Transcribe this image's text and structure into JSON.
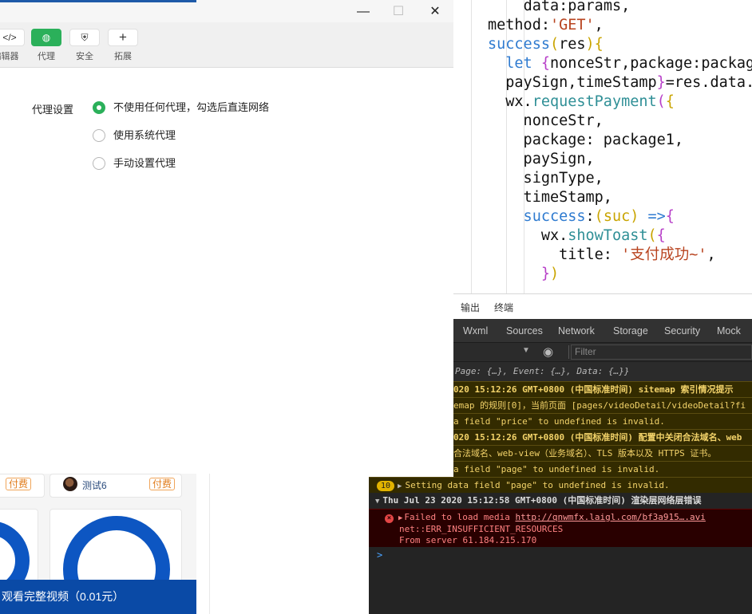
{
  "editor": {
    "lines": [
      [
        {
          "t": "    ",
          "c": "d"
        },
        {
          "t": "data",
          "c": "d"
        },
        {
          "t": ":params,",
          "c": "d"
        }
      ],
      [
        {
          "t": "method",
          "c": "d"
        },
        {
          "t": ":",
          "c": "d"
        },
        {
          "t": "'GET'",
          "c": "s"
        },
        {
          "t": ",",
          "c": "d"
        }
      ],
      [
        {
          "t": "success",
          "c": "k"
        },
        {
          "t": "(",
          "c": "b1"
        },
        {
          "t": "res",
          "c": "d"
        },
        {
          "t": ")",
          "c": "b1"
        },
        {
          "t": "{",
          "c": "b1"
        }
      ],
      [
        {
          "t": "  let ",
          "c": "k"
        },
        {
          "t": "{",
          "c": "b2"
        },
        {
          "t": "nonceStr,package:packag",
          "c": "d"
        }
      ],
      [
        {
          "t": "  paySign,timeStamp",
          "c": "d"
        },
        {
          "t": "}",
          "c": "b2"
        },
        {
          "t": "=res.data.",
          "c": "d"
        }
      ],
      [
        {
          "t": "  wx.",
          "c": "d"
        },
        {
          "t": "requestPayment",
          "c": "f"
        },
        {
          "t": "(",
          "c": "b2"
        },
        {
          "t": "{",
          "c": "b1"
        }
      ],
      [
        {
          "t": "    nonceStr,",
          "c": "d"
        }
      ],
      [
        {
          "t": "    package",
          "c": "d"
        },
        {
          "t": ": package1,",
          "c": "d"
        }
      ],
      [
        {
          "t": "    paySign,",
          "c": "d"
        }
      ],
      [
        {
          "t": "    signType,",
          "c": "d"
        }
      ],
      [
        {
          "t": "    timeStamp,",
          "c": "d"
        }
      ],
      [
        {
          "t": "    success",
          "c": "k"
        },
        {
          "t": ":",
          "c": "d"
        },
        {
          "t": "(",
          "c": "b1"
        },
        {
          "t": "suc",
          "c": "b1"
        },
        {
          "t": ") ",
          "c": "b1"
        },
        {
          "t": "=>",
          "c": "k"
        },
        {
          "t": "{",
          "c": "b2"
        }
      ],
      [
        {
          "t": "      wx.",
          "c": "d"
        },
        {
          "t": "showToast",
          "c": "f"
        },
        {
          "t": "(",
          "c": "b1"
        },
        {
          "t": "{",
          "c": "b2"
        }
      ],
      [
        {
          "t": "        title",
          "c": "d"
        },
        {
          "t": ": ",
          "c": "d"
        },
        {
          "t": "'支付成功~'",
          "c": "s"
        },
        {
          "t": ",",
          "c": "d"
        }
      ],
      [
        {
          "t": "      }",
          "c": "b2"
        },
        {
          "t": ")",
          "c": "b1"
        }
      ]
    ]
  },
  "dialog": {
    "toolbar": [
      {
        "icon": "</>",
        "icon_name": "code-icon",
        "label": "编辑器"
      },
      {
        "icon": "◍",
        "icon_name": "globe-icon",
        "label": "代理",
        "active": true
      },
      {
        "icon": "⛨",
        "icon_name": "shield-icon",
        "label": "安全"
      },
      {
        "icon": "+",
        "icon_name": "plus-icon",
        "label": "拓展"
      }
    ],
    "proxy_label": "代理设置",
    "options": [
      {
        "label": "不使用任何代理，勾选后直连网络",
        "selected": true
      },
      {
        "label": "使用系统代理",
        "selected": false
      },
      {
        "label": "手动设置代理",
        "selected": false
      }
    ],
    "window_buttons": {
      "minimize": "—",
      "maximize": "☐",
      "close": "✕"
    }
  },
  "simulator": {
    "tag_label": "付费",
    "user_name": "测试6",
    "pay_bar": "观看完整视频（0.01元）"
  },
  "devtools": {
    "top_tabs": [
      "输出",
      "终端"
    ],
    "tabs": [
      "Wxml",
      "Sources",
      "Network",
      "Storage",
      "Security",
      "Mock"
    ],
    "filter_placeholder": "Filter",
    "console": {
      "l1": "Page: {…}, Event: {…}, Data: {…}}",
      "l2": "020 15:12:26 GMT+0800 (中国标准时间) sitemap 索引情况提示",
      "l3": "emap 的规则[0]，当前页面 [pages/videoDetail/videoDetail?fi",
      "l4": "a field \"price\" to undefined is invalid.",
      "l5": "020 15:12:26 GMT+0800 (中国标准时间) 配置中关闭合法域名、web",
      "l6": "合法域名、web-view（业务域名）、TLS 版本以及 HTTPS 证书。",
      "l7": "a field \"page\" to undefined is invalid.",
      "badge": "10",
      "l8": "Setting data field \"page\" to undefined is invalid.",
      "l9": "Thu Jul 23 2020 15:12:58 GMT+0800 (中国标准时间) 渲染层网络层错误",
      "e1_prefix": "Failed to load media ",
      "e1_link": "http://qnwmfx.laigl.com/bf3a915….avi",
      "e2": "net::ERR_INSUFFICIENT_RESOURCES",
      "e3": "From server 61.184.215.170",
      "prompt": ">"
    }
  }
}
